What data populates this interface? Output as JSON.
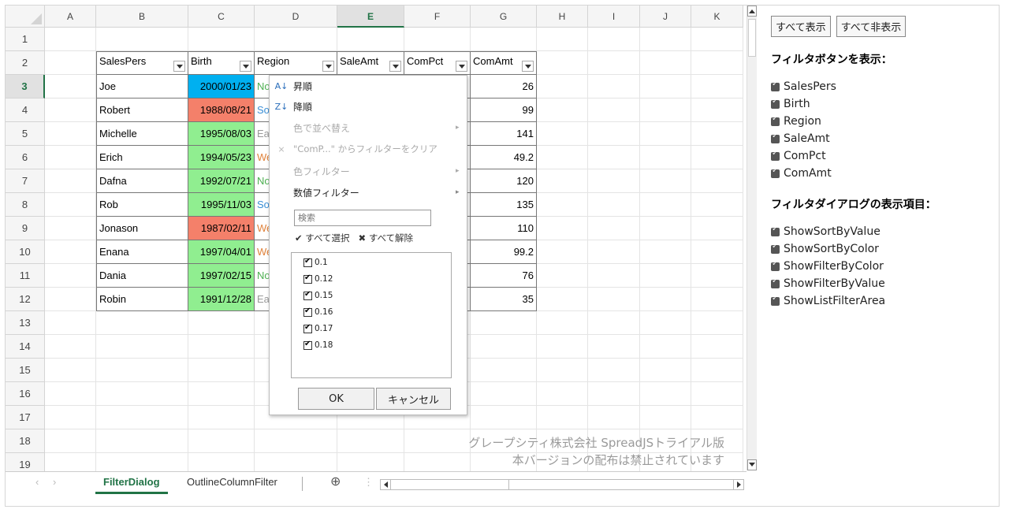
{
  "spreadsheet": {
    "columns": [
      "A",
      "B",
      "C",
      "D",
      "E",
      "F",
      "G",
      "H",
      "I",
      "J",
      "K"
    ],
    "selected_column": "E",
    "rows": [
      "1",
      "2",
      "3",
      "4",
      "5",
      "6",
      "7",
      "8",
      "9",
      "10",
      "11",
      "12",
      "13",
      "14",
      "15",
      "16",
      "17",
      "18",
      "19"
    ],
    "selected_row": "3",
    "headers": [
      "SalesPers",
      "Birth",
      "Region",
      "SaleAmt",
      "ComPct",
      "ComAmt"
    ],
    "data": [
      {
        "name": "Joe",
        "birth": "2000/01/23",
        "region": "No",
        "com": "26",
        "f": "",
        "birth_color": "#00b0f0",
        "region_color": "#4caf50"
      },
      {
        "name": "Robert",
        "birth": "1988/08/21",
        "region": "So",
        "com": "99",
        "f": "",
        "birth_color": "#f4806a",
        "region_color": "#3b8fd6"
      },
      {
        "name": "Michelle",
        "birth": "1995/08/03",
        "region": "Ea",
        "com": "141",
        "f": "",
        "birth_color": "#90ee90",
        "region_color": "#999999"
      },
      {
        "name": "Erich",
        "birth": "1994/05/23",
        "region": "We",
        "com": "49.2",
        "f": "",
        "birth_color": "#90ee90",
        "region_color": "#e0823b"
      },
      {
        "name": "Dafna",
        "birth": "1992/07/21",
        "region": "No",
        "com": "120",
        "f": "",
        "birth_color": "#90ee90",
        "region_color": "#4caf50"
      },
      {
        "name": "Rob",
        "birth": "1995/11/03",
        "region": "So",
        "com": "135",
        "f": "",
        "birth_color": "#90ee90",
        "region_color": "#3b8fd6"
      },
      {
        "name": "Jonason",
        "birth": "1987/02/11",
        "region": "We",
        "com": "110",
        "f": "",
        "birth_color": "#f4806a",
        "region_color": "#e0823b"
      },
      {
        "name": "Enana",
        "birth": "1997/04/01",
        "region": "We",
        "com": "99.2",
        "f": "",
        "birth_color": "#90ee90",
        "region_color": "#e0823b"
      },
      {
        "name": "Dania",
        "birth": "1997/02/15",
        "region": "No",
        "com": "76",
        "f": "",
        "birth_color": "#90ee90",
        "region_color": "#4caf50"
      },
      {
        "name": "Robin",
        "birth": "1991/12/28",
        "region": "Ea",
        "com": "35",
        "f": "",
        "birth_color": "#90ee90",
        "region_color": "#999999"
      }
    ],
    "watermark_line1": "グレープシティ株式会社 SpreadJSトライアル版",
    "watermark_line2": "本バージョンの配布は禁止されています"
  },
  "tabs": {
    "active": "FilterDialog",
    "other": "OutlineColumnFilter",
    "add_icon": "⊕",
    "more_icon": "⋮"
  },
  "filter_dialog": {
    "sort_asc": "昇順",
    "sort_desc": "降順",
    "sort_by_color": "色で並べ替え",
    "clear_filter": "\"ComP...\" からフィルターをクリア",
    "color_filter": "色フィルター",
    "number_filter": "数値フィルター",
    "search_placeholder": "検索",
    "select_all": "すべて選択",
    "deselect_all": "すべて解除",
    "values": [
      "0.1",
      "0.12",
      "0.15",
      "0.16",
      "0.17",
      "0.18"
    ],
    "ok": "OK",
    "cancel": "キャンセル"
  },
  "side_panel": {
    "show_all": "すべて表示",
    "hide_all": "すべて非表示",
    "filter_button_heading": "フィルタボタンを表示：",
    "filter_buttons": [
      "SalesPers",
      "Birth",
      "Region",
      "SaleAmt",
      "ComPct",
      "ComAmt"
    ],
    "dialog_items_heading": "フィルタダイアログの表示項目：",
    "dialog_items": [
      "ShowSortByValue",
      "ShowSortByColor",
      "ShowFilterByColor",
      "ShowFilterByValue",
      "ShowListFilterArea"
    ]
  }
}
